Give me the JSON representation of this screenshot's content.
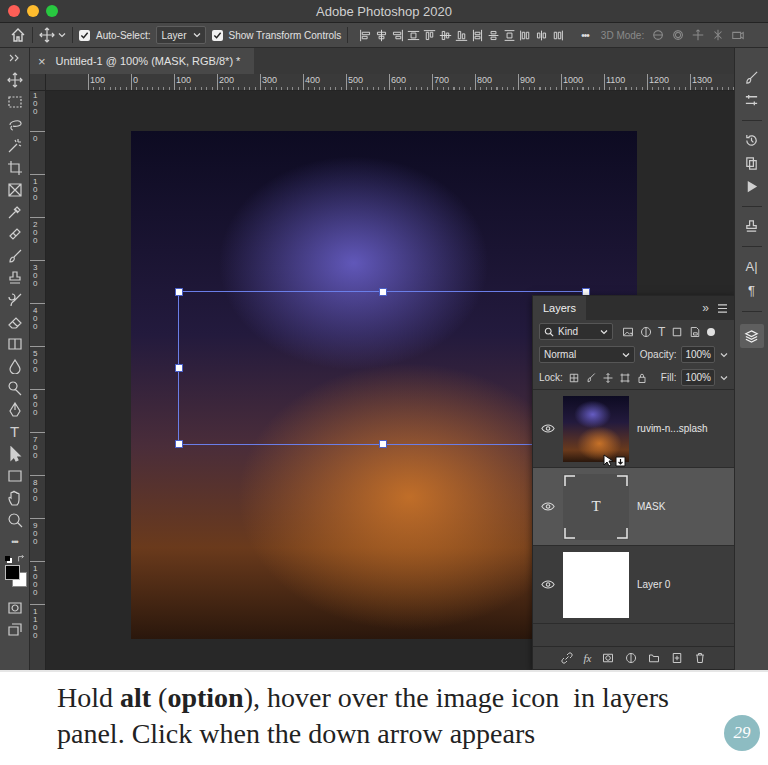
{
  "window": {
    "title": "Adobe Photoshop 2020"
  },
  "options_bar": {
    "auto_select": {
      "label": "Auto-Select:",
      "checked": true,
      "value": "Layer"
    },
    "show_transform": {
      "label": "Show Transform Controls",
      "checked": true
    },
    "more": "•••",
    "mode_3d": {
      "label": "3D Mode:",
      "disabled": true
    }
  },
  "document_tab": {
    "close": "×",
    "title": "Untitled-1 @ 100% (MASK, RGB/8*) *",
    "selected": true
  },
  "rulers": {
    "horizontal": [
      "100",
      "0",
      "100",
      "200",
      "300",
      "400",
      "500",
      "600",
      "700",
      "800",
      "900",
      "1000",
      "1100",
      "1200",
      "1300"
    ],
    "vertical": [
      "100",
      "0",
      "100",
      "200",
      "300",
      "400",
      "500",
      "600",
      "700",
      "800",
      "900",
      "1000",
      "1100"
    ]
  },
  "toolbar": {
    "type_tool": "T",
    "more": "•••"
  },
  "right_strip": {
    "character": "A|",
    "paragraph": "¶"
  },
  "layers_panel": {
    "title": "Layers",
    "collapse": "»",
    "filter": {
      "value": "Kind"
    },
    "filter_type": "T",
    "blend_mode": "Normal",
    "opacity": {
      "label": "Opacity:",
      "value": "100%"
    },
    "lock": {
      "label": "Lock:"
    },
    "fill": {
      "label": "Fill:",
      "value": "100%"
    },
    "layers": [
      {
        "name": "ruvim-n...splash",
        "kind": "image",
        "visible": true,
        "selected": false
      },
      {
        "name": "MASK",
        "kind": "text",
        "thumb_glyph": "T",
        "visible": true,
        "selected": true
      },
      {
        "name": "Layer 0",
        "kind": "fill",
        "visible": true,
        "selected": false
      }
    ],
    "footer_fx": "fx"
  },
  "caption": [
    {
      "text": "Hold ",
      "bold": false
    },
    {
      "text": "alt",
      "bold": true
    },
    {
      "text": " (",
      "bold": false
    },
    {
      "text": "option",
      "bold": true
    },
    {
      "text": "), hover over the image icon  in layers panel. Click when the down arrow appears",
      "bold": false
    }
  ],
  "logo": "29"
}
